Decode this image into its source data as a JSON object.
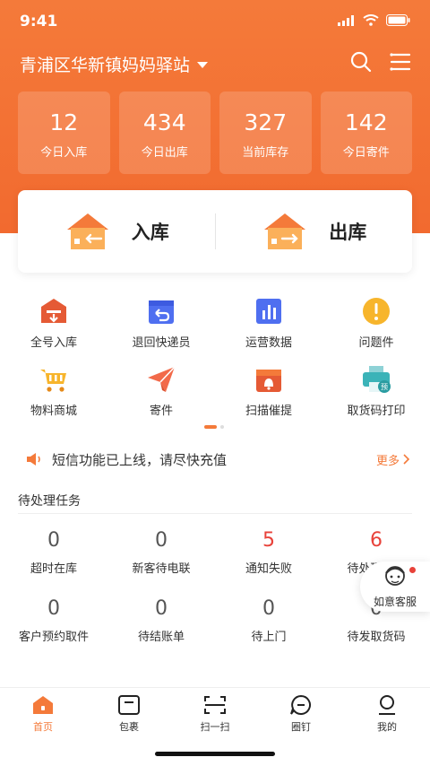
{
  "status_bar": {
    "time": "9:41"
  },
  "header": {
    "station_name": "青浦区华新镇妈妈驿站"
  },
  "stats": [
    {
      "value": "12",
      "label": "今日入库"
    },
    {
      "value": "434",
      "label": "今日出库"
    },
    {
      "value": "327",
      "label": "当前库存"
    },
    {
      "value": "142",
      "label": "今日寄件"
    }
  ],
  "io": {
    "inbound_label": "入库",
    "outbound_label": "出库"
  },
  "grid": [
    {
      "label": "全号入库",
      "icon": "box-down-icon"
    },
    {
      "label": "退回快递员",
      "icon": "return-box-icon"
    },
    {
      "label": "运营数据",
      "icon": "bar-chart-icon"
    },
    {
      "label": "问题件",
      "icon": "warning-icon"
    },
    {
      "label": "物料商城",
      "icon": "cart-icon"
    },
    {
      "label": "寄件",
      "icon": "paper-plane-icon"
    },
    {
      "label": "扫描催提",
      "icon": "bell-box-icon"
    },
    {
      "label": "取货码打印",
      "icon": "printer-icon"
    }
  ],
  "notice": {
    "text": "短信功能已上线，请尽快充值",
    "more_label": "更多"
  },
  "tasks_section": {
    "title": "待处理任务",
    "items": [
      {
        "value": "0",
        "label": "超时在库"
      },
      {
        "value": "0",
        "label": "新客待电联"
      },
      {
        "value": "5",
        "label": "通知失败"
      },
      {
        "value": "6",
        "label": "待处理投诉"
      },
      {
        "value": "0",
        "label": "客户预约取件"
      },
      {
        "value": "0",
        "label": "待结账单"
      },
      {
        "value": "0",
        "label": "待上门"
      },
      {
        "value": "0",
        "label": "待发取货码"
      }
    ]
  },
  "customer_service": {
    "label": "如意客服"
  },
  "tabbar": [
    {
      "label": "首页",
      "icon": "home-icon"
    },
    {
      "label": "包裹",
      "icon": "package-icon"
    },
    {
      "label": "扫一扫",
      "icon": "scan-icon"
    },
    {
      "label": "圈钉",
      "icon": "chat-icon"
    },
    {
      "label": "我的",
      "icon": "user-icon"
    }
  ],
  "colors": {
    "brand": "#f47a3a",
    "alert": "#e8423a"
  }
}
